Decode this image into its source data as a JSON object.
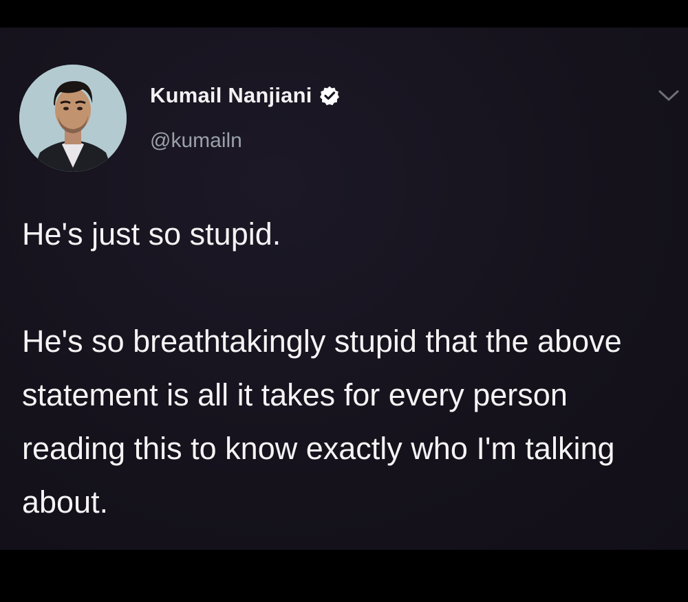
{
  "tweet": {
    "author": {
      "display_name": "Kumail Nanjiani",
      "handle": "@kumailn",
      "verified": true
    },
    "paragraphs": [
      "He's just so stupid.",
      "He's so breathtakingly stupid that the above statement is all it takes for every person reading this to know exactly who I'm talking about."
    ]
  },
  "icons": {
    "verified": "verified-badge-icon",
    "more": "chevron-down-icon"
  },
  "colors": {
    "background": "#17141f",
    "text": "#f4f4f4",
    "handle": "#9aa1a8",
    "outer_border": "#000000"
  }
}
